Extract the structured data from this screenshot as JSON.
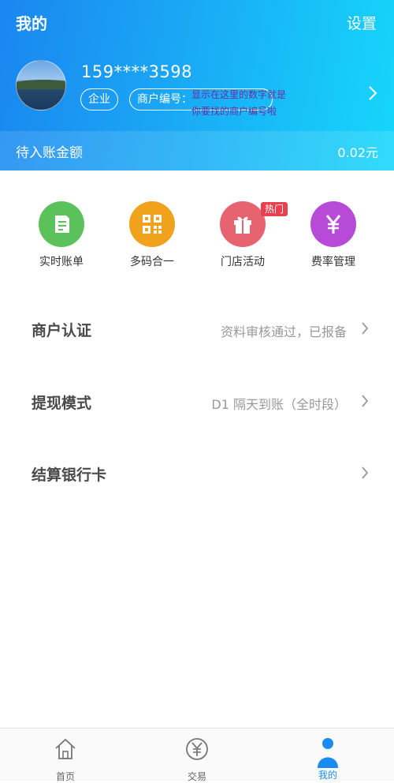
{
  "header": {
    "title": "我的",
    "settings_label": "设置",
    "phone": "159****3598",
    "account_type": "企业",
    "merchant_no_label": "商户编号：",
    "annotation_line1": "显示在这里的数字就是",
    "annotation_line2": "你要找的商户编号啦",
    "pending_label": "待入账金额",
    "pending_value": "0.02元"
  },
  "quick_actions": [
    {
      "label": "实时账单",
      "icon": "bill-icon",
      "color": "#5bc25b"
    },
    {
      "label": "多码合一",
      "icon": "qrcode-icon",
      "color": "#f0a21c"
    },
    {
      "label": "门店活动",
      "icon": "gift-icon",
      "color": "#e86370"
    },
    {
      "label": "费率管理",
      "icon": "yuan-icon",
      "color": "#b84ad8"
    }
  ],
  "hot_badge": "热门",
  "rows": [
    {
      "title": "商户认证",
      "value": "资料审核通过，已报备"
    },
    {
      "title": "提现模式",
      "value": "D1 隔天到账（全时段）"
    },
    {
      "title": "结算银行卡",
      "value": ""
    }
  ],
  "tabbar": [
    {
      "label": "首页",
      "icon": "home-icon"
    },
    {
      "label": "交易",
      "icon": "yuan-circle-icon"
    },
    {
      "label": "我的",
      "icon": "person-icon"
    }
  ],
  "colors": {
    "header_start": "#1a86f0",
    "header_end": "#16d7fb",
    "active_tab": "#1a8cf0"
  }
}
